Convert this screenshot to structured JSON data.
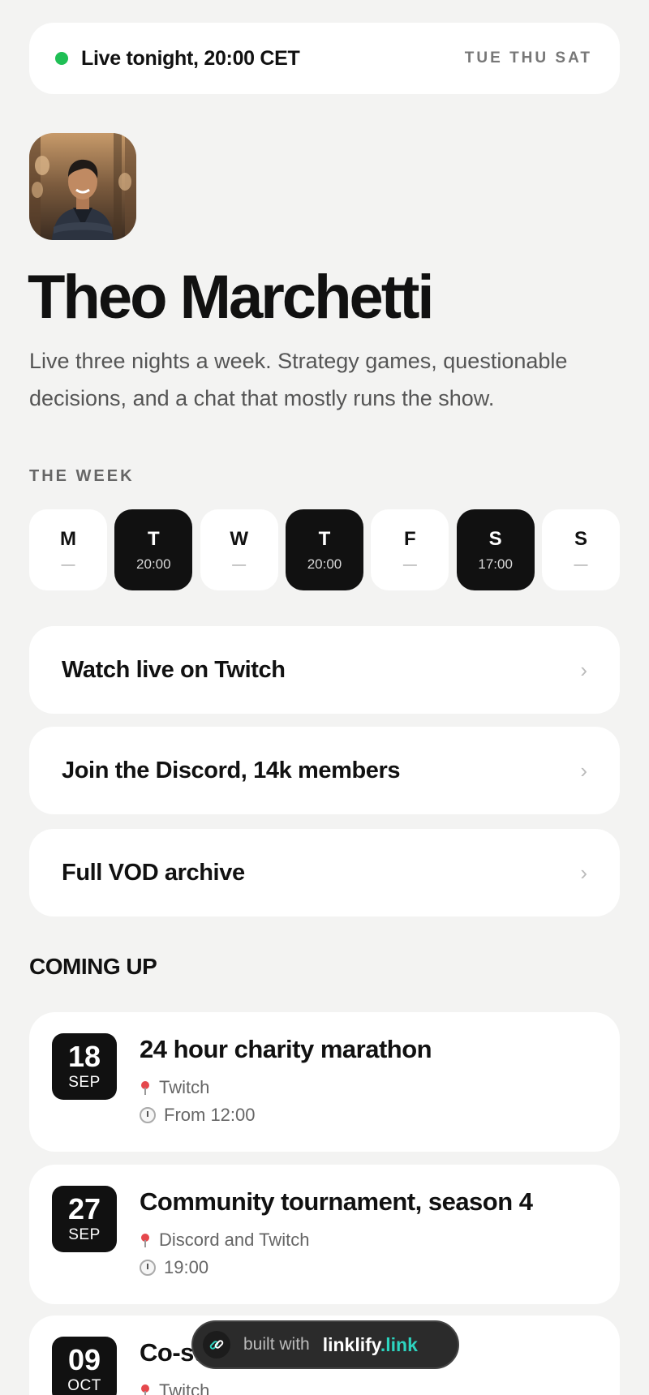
{
  "status": {
    "live_text": "Live tonight, 20:00 CET",
    "days": "TUE THU SAT",
    "dot_color": "#1fbf55"
  },
  "profile": {
    "name": "Theo Marchetti",
    "bio": "Live three nights a week. Strategy games, questionable decisions, and a chat that mostly runs the show."
  },
  "week": {
    "heading": "THE WEEK",
    "days": [
      {
        "letter": "M",
        "time": "—",
        "active": false
      },
      {
        "letter": "T",
        "time": "20:00",
        "active": true
      },
      {
        "letter": "W",
        "time": "—",
        "active": false
      },
      {
        "letter": "T",
        "time": "20:00",
        "active": true
      },
      {
        "letter": "F",
        "time": "—",
        "active": false
      },
      {
        "letter": "S",
        "time": "17:00",
        "active": true
      },
      {
        "letter": "S",
        "time": "—",
        "active": false
      }
    ]
  },
  "links": [
    {
      "label": "Watch live on Twitch",
      "icon": "chevron-right-icon"
    },
    {
      "label": "Join the Discord, 14k members",
      "icon": "chevron-right-icon"
    },
    {
      "label": "Full VOD archive",
      "icon": "chevron-right-icon"
    }
  ],
  "coming_up": {
    "heading": "COMING UP",
    "events": [
      {
        "day": "18",
        "month": "SEP",
        "title": "24 hour charity marathon",
        "location": "Twitch",
        "time": "From 12:00"
      },
      {
        "day": "27",
        "month": "SEP",
        "title": "Community tournament, season 4",
        "location": "Discord and Twitch",
        "time": "19:00"
      },
      {
        "day": "09",
        "month": "OCT",
        "title": "Co-stream",
        "location": "Twitch",
        "time": ""
      }
    ]
  },
  "badge": {
    "prefix": "built with",
    "brand": "linklify",
    "tld": ".link",
    "accent": "#2dd4bf"
  }
}
